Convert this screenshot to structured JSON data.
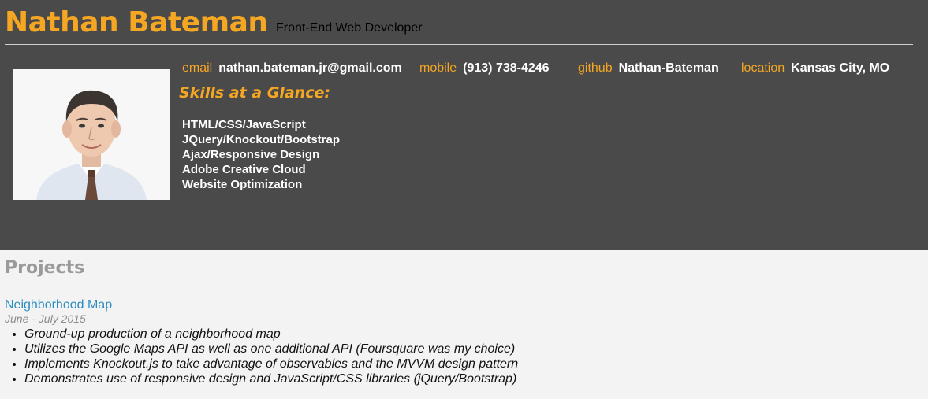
{
  "header": {
    "name": "Nathan Bateman",
    "role": "Front-End Web Developer",
    "contacts": [
      {
        "label": "email",
        "value": "nathan.bateman.jr@gmail.com"
      },
      {
        "label": "mobile",
        "value": "(913) 738-4246"
      },
      {
        "label": "github",
        "value": "Nathan-Bateman"
      },
      {
        "label": "location",
        "value": "Kansas City, MO"
      }
    ],
    "skills_title": "Skills at a Glance:",
    "skills": [
      "HTML/CSS/JavaScript",
      "JQuery/Knockout/Bootstrap",
      "Ajax/Responsive Design",
      "Adobe Creative Cloud",
      "Website Optimization"
    ]
  },
  "projects": {
    "title": "Projects",
    "items": [
      {
        "name": "Neighborhood Map",
        "dates": "June - July 2015",
        "bullets": [
          "Ground-up production of a neighborhood map",
          "Utilizes the Google Maps API as well as one additional API (Foursquare was my choice)",
          "Implements Knockout.js to take advantage of observables and the MVVM design pattern",
          "Demonstrates use of responsive design and JavaScript/CSS libraries (jQuery/Bootstrap)"
        ]
      }
    ]
  },
  "colors": {
    "header_bg": "#4a4a4a",
    "accent": "#f5a623",
    "page_bg": "#f3f3f3",
    "link": "#2a8dbf"
  }
}
